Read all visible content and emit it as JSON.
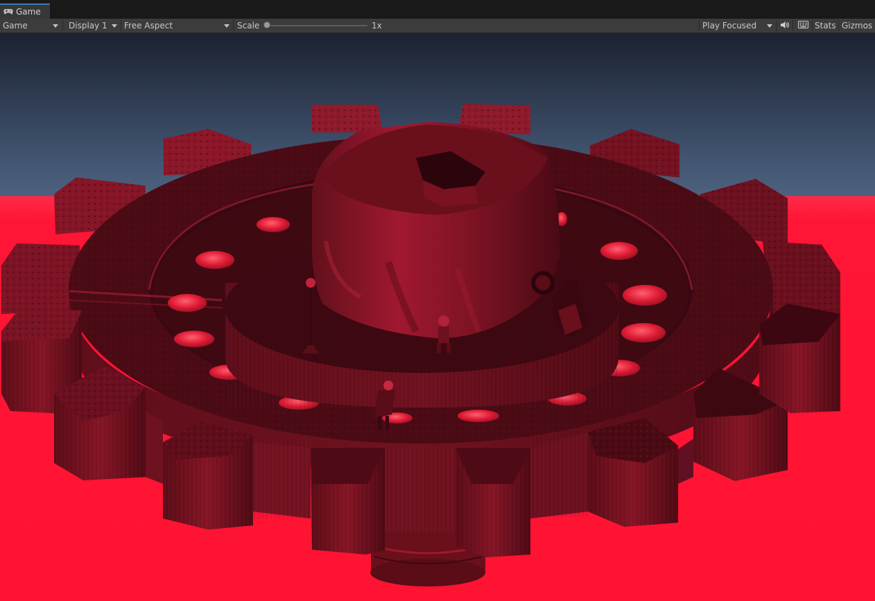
{
  "window": {
    "tab": {
      "label": "Game",
      "icon": "gamepad-icon"
    }
  },
  "toolbar": {
    "view_mode": "Game",
    "display": "Display 1",
    "aspect": "Free Aspect",
    "scale_label": "Scale",
    "scale_value": 1,
    "scale_text": "1x",
    "play_mode": "Play Focused",
    "mute_icon": "speaker-icon",
    "shortcuts_icon": "keyboard-icon",
    "stats_label": "Stats",
    "gizmos_label": "Gizmos"
  },
  "scene": {
    "sky_top_color": "#1c2230",
    "sky_horizon_color": "#495d78",
    "ground_color": "#ff1535",
    "object_color": "#8a1424",
    "object": "gear-platform-with-hex-nut"
  }
}
